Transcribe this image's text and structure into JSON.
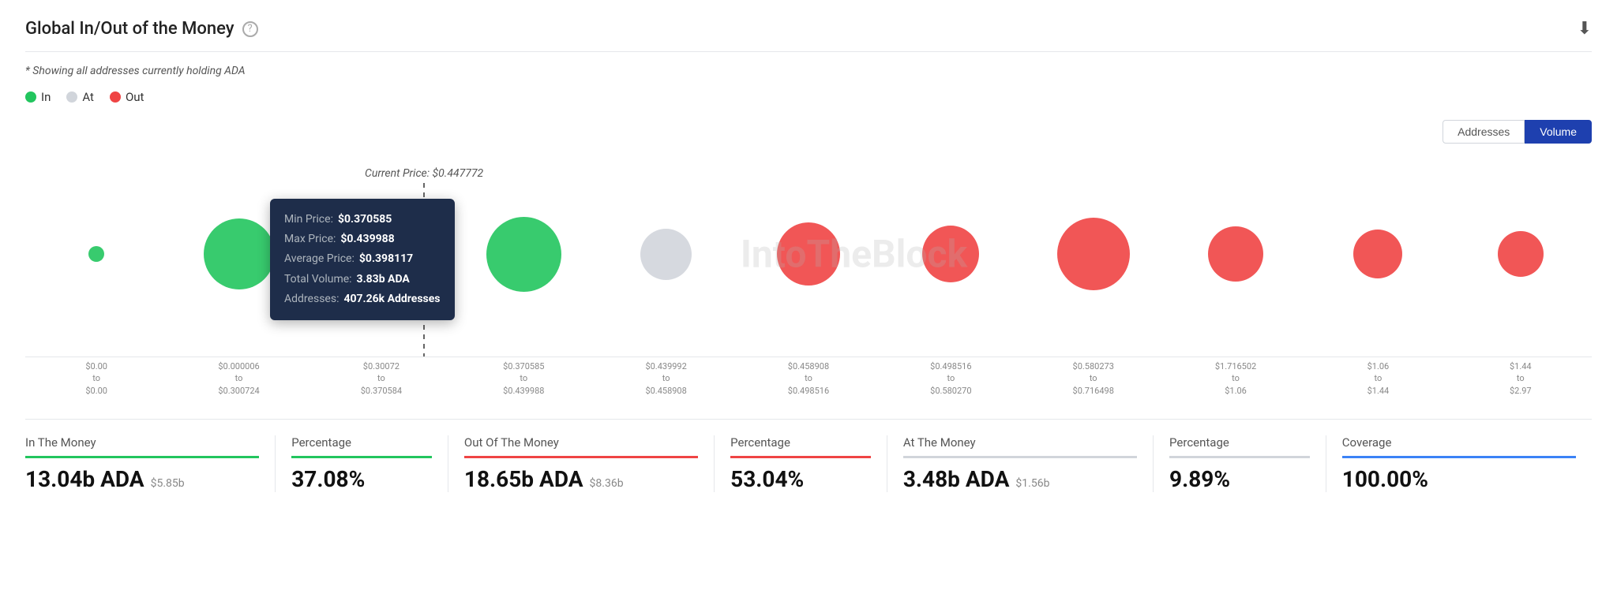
{
  "header": {
    "title": "Global In/Out of the Money",
    "subtitle": "* Showing all addresses currently holding ADA"
  },
  "legend": {
    "items": [
      {
        "label": "In",
        "color": "green"
      },
      {
        "label": "At",
        "color": "gray"
      },
      {
        "label": "Out",
        "color": "red"
      }
    ]
  },
  "controls": {
    "addresses_label": "Addresses",
    "volume_label": "Volume"
  },
  "chart": {
    "current_price_label": "Current Price: $0.447772",
    "watermark": "IntoTheBlock"
  },
  "tooltip": {
    "min_price_label": "Min Price:",
    "min_price_value": "$0.370585",
    "max_price_label": "Max Price:",
    "max_price_value": "$0.439988",
    "avg_price_label": "Average Price:",
    "avg_price_value": "$0.398117",
    "total_vol_label": "Total Volume:",
    "total_vol_value": "3.83b ADA",
    "addresses_label": "Addresses:",
    "addresses_value": "407.26k Addresses"
  },
  "bubbles": [
    {
      "size": 20,
      "color": "green",
      "x_from": "$0.00",
      "x_to": "$0.00"
    },
    {
      "size": 90,
      "color": "green",
      "x_from": "$0.000006",
      "x_to": "$0.300724"
    },
    {
      "size": 75,
      "color": "green",
      "x_from": "$0.300724",
      "x_to": "$0.370584"
    },
    {
      "size": 95,
      "color": "green",
      "x_from": "$0.370585",
      "x_to": "$0.439988",
      "tooltip": true
    },
    {
      "size": 65,
      "color": "gray",
      "x_from": "$0.439992",
      "x_to": "$0.458908"
    },
    {
      "size": 80,
      "color": "red",
      "x_from": "$0.458908",
      "x_to": "$0.498516"
    },
    {
      "size": 72,
      "color": "red",
      "x_from": "$0.498516",
      "x_to": "$0.580270"
    },
    {
      "size": 92,
      "color": "red",
      "x_from": "$0.580273",
      "x_to": "$0.716498"
    },
    {
      "size": 70,
      "color": "red",
      "x_from": "$1.716502",
      "x_to": "$1.06"
    },
    {
      "size": 62,
      "color": "red",
      "x_from": "$1.06",
      "x_to": "$1.44"
    },
    {
      "size": 58,
      "color": "red",
      "x_from": "$1.44",
      "x_to": "$2.97"
    }
  ],
  "xaxis": [
    {
      "from": "$0.00",
      "to": "$0.00"
    },
    {
      "from": "$0.000006",
      "to": "$0.300724"
    },
    {
      "from": "$0.300724",
      "to": "$0.370584"
    },
    {
      "from": "$0.370585",
      "to": "$0.439988"
    },
    {
      "from": "$0.439992",
      "to": "$0.458908"
    },
    {
      "from": "$0.458908",
      "to": "$0.498516"
    },
    {
      "from": "$0.498516",
      "to": "$0.580270"
    },
    {
      "from": "$0.580273",
      "to": "$0.716498"
    },
    {
      "from": "$1.716502",
      "to": "$1.06"
    },
    {
      "from": "$1.06",
      "to": "$1.44"
    },
    {
      "from": "$1.44",
      "to": "$2.97"
    }
  ],
  "summary": {
    "in_the_money": {
      "label": "In The Money",
      "main": "13.04b ADA",
      "sub": "$5.85b",
      "percentage": "37.08%"
    },
    "out_of_the_money": {
      "label": "Out Of The Money",
      "main": "18.65b ADA",
      "sub": "$8.36b",
      "percentage": "53.04%"
    },
    "at_the_money": {
      "label": "At The Money",
      "main": "3.48b ADA",
      "sub": "$1.56b",
      "percentage": "9.89%"
    },
    "coverage": {
      "label": "Coverage",
      "value": "100.00%"
    }
  }
}
